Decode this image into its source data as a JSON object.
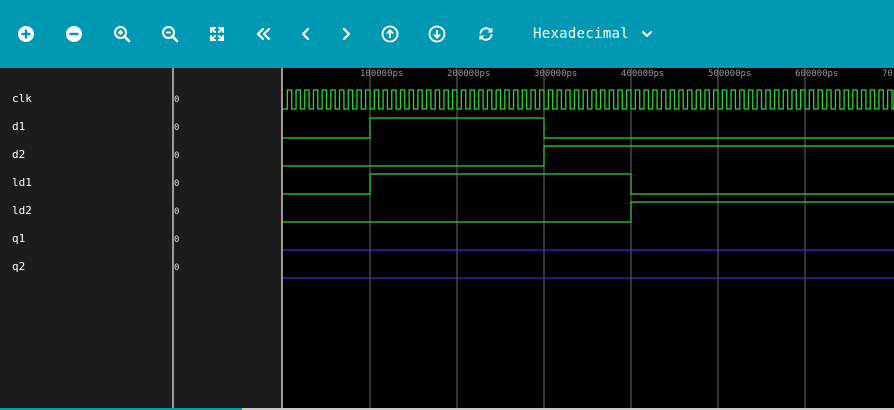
{
  "toolbar": {
    "buttons": [
      {
        "name": "zoom-in-add-icon"
      },
      {
        "name": "zoom-out-remove-icon"
      },
      {
        "name": "zoom-in-magnifier-icon"
      },
      {
        "name": "zoom-out-magnifier-icon"
      },
      {
        "name": "fit-expand-icon"
      },
      {
        "name": "first-double-chevron-left-icon"
      },
      {
        "name": "previous-chevron-left-icon"
      },
      {
        "name": "next-chevron-right-icon"
      },
      {
        "name": "arrow-up-circle-icon"
      },
      {
        "name": "arrow-down-circle-icon"
      },
      {
        "name": "refresh-icon"
      }
    ],
    "radix_label": "Hexadecimal",
    "accent": "#0098b3"
  },
  "timeline": {
    "labels": [
      "100000ps",
      "200000ps",
      "300000ps",
      "400000ps",
      "500000ps",
      "600000ps",
      "70"
    ]
  },
  "signals": [
    {
      "name": "clk",
      "value": "0"
    },
    {
      "name": "d1",
      "value": "0"
    },
    {
      "name": "d2",
      "value": "0"
    },
    {
      "name": "ld1",
      "value": "0"
    },
    {
      "name": "ld2",
      "value": "0"
    },
    {
      "name": "q1",
      "value": "0"
    },
    {
      "name": "q2",
      "value": "0"
    }
  ],
  "colors": {
    "wave_green": "#2fd23a",
    "wave_blue": "#3a2cd6",
    "grid": "#6a6a6a"
  }
}
